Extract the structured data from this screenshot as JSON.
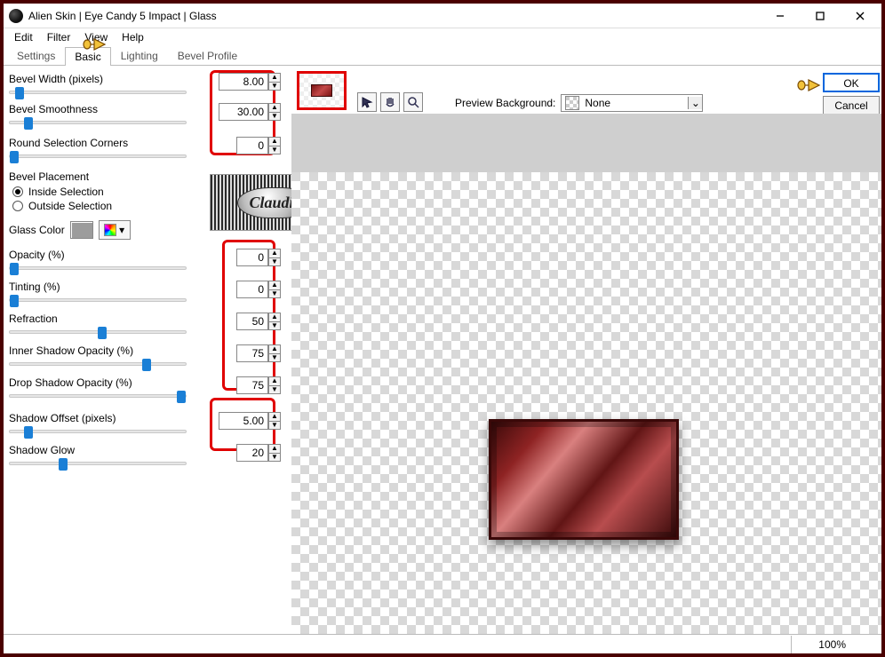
{
  "window": {
    "title": "Alien Skin | Eye Candy 5 Impact | Glass",
    "minimize_icon": "minimize-icon",
    "maximize_icon": "maximize-icon",
    "close_icon": "close-icon"
  },
  "menubar": [
    "Edit",
    "Filter",
    "View",
    "Help"
  ],
  "tabs": [
    "Settings",
    "Basic",
    "Lighting",
    "Bevel Profile"
  ],
  "active_tab": "Basic",
  "params": {
    "bevel_width": {
      "label": "Bevel Width (pixels)",
      "value": "8.00",
      "thumb_pct": 3
    },
    "bevel_smoothness": {
      "label": "Bevel Smoothness",
      "value": "30.00",
      "thumb_pct": 8
    },
    "round_corners": {
      "label": "Round Selection Corners",
      "value": "0",
      "thumb_pct": 0
    },
    "opacity": {
      "label": "Opacity (%)",
      "value": "0",
      "thumb_pct": 0
    },
    "tinting": {
      "label": "Tinting (%)",
      "value": "0",
      "thumb_pct": 0
    },
    "refraction": {
      "label": "Refraction",
      "value": "50",
      "thumb_pct": 50
    },
    "inner_shadow": {
      "label": "Inner Shadow Opacity (%)",
      "value": "75",
      "thumb_pct": 75
    },
    "drop_shadow": {
      "label": "Drop Shadow Opacity (%)",
      "value": "75",
      "thumb_pct": 95
    },
    "shadow_offset": {
      "label": "Shadow Offset (pixels)",
      "value": "5.00",
      "thumb_pct": 8
    },
    "shadow_glow": {
      "label": "Shadow Glow",
      "value": "20",
      "thumb_pct": 28
    }
  },
  "bevel_placement": {
    "title": "Bevel Placement",
    "inside": "Inside Selection",
    "outside": "Outside Selection",
    "selected": "inside"
  },
  "glass_color": {
    "label": "Glass Color",
    "hex": "#9c9c9c"
  },
  "logo_text": "Claudia",
  "preview": {
    "bg_label": "Preview Background:",
    "bg_value": "None"
  },
  "buttons": {
    "ok": "OK",
    "cancel": "Cancel"
  },
  "status": {
    "zoom": "100%"
  },
  "tool_icons": [
    "pointer-icon",
    "hand-icon",
    "zoom-icon"
  ]
}
